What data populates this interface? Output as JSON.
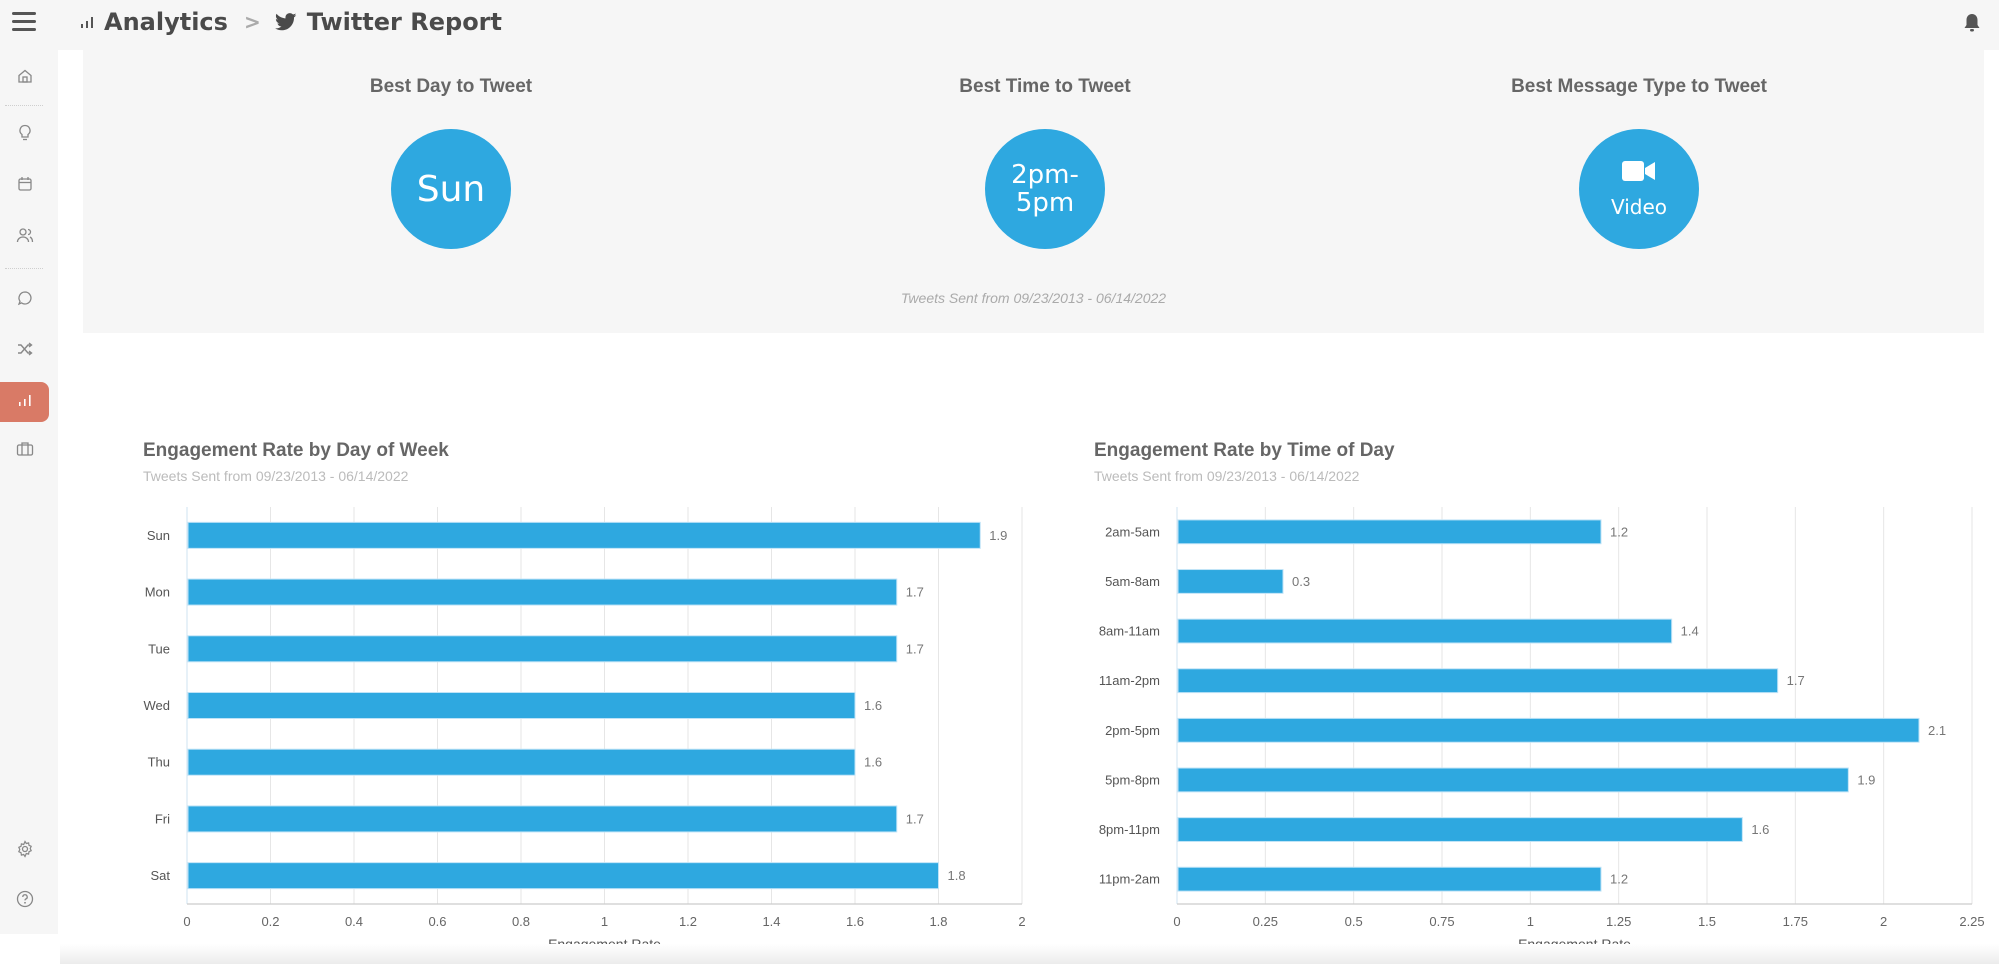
{
  "header": {
    "breadcrumb": [
      {
        "label": "Analytics",
        "icon": "analytics-icon"
      },
      {
        "label": "Twitter Report",
        "icon": "twitter-icon"
      }
    ],
    "separator": ">",
    "notifications_icon": "bell-icon"
  },
  "sidebar": {
    "items": [
      {
        "name": "home",
        "icon": "home-icon",
        "active": false
      },
      {
        "name": "ideas",
        "icon": "lightbulb-icon",
        "active": false
      },
      {
        "name": "calendar",
        "icon": "calendar-icon",
        "active": false
      },
      {
        "name": "audience",
        "icon": "users-icon",
        "active": false
      },
      {
        "name": "messages",
        "icon": "chat-icon",
        "active": false
      },
      {
        "name": "automation",
        "icon": "shuffle-icon",
        "active": false
      },
      {
        "name": "analytics",
        "icon": "analytics-icon",
        "active": true
      },
      {
        "name": "tools",
        "icon": "briefcase-icon",
        "active": false
      },
      {
        "name": "settings",
        "icon": "gear-icon",
        "active": false
      },
      {
        "name": "help",
        "icon": "help-icon",
        "active": false
      }
    ],
    "active_color": "#d97a66"
  },
  "summary": {
    "cards": [
      {
        "title": "Best Day to Tweet",
        "value": "Sun"
      },
      {
        "title": "Best Time to Tweet",
        "value_line1": "2pm-",
        "value_line2": "5pm"
      },
      {
        "title": "Best Message Type to Tweet",
        "value": "Video",
        "icon": "video-camera-icon"
      }
    ],
    "note": "Tweets Sent from 09/23/2013 - 06/14/2022",
    "accent": "#2ea8e0"
  },
  "chart_data": [
    {
      "type": "bar",
      "orientation": "horizontal",
      "title": "Engagement Rate by Day of Week",
      "subtitle": "Tweets Sent from 09/23/2013 - 06/14/2022",
      "categories": [
        "Sun",
        "Mon",
        "Tue",
        "Wed",
        "Thu",
        "Fri",
        "Sat"
      ],
      "values": [
        1.9,
        1.7,
        1.7,
        1.6,
        1.6,
        1.7,
        1.8
      ],
      "value_labels": [
        "1.9",
        "1.7",
        "1.7",
        "1.6",
        "1.6",
        "1.7",
        "1.8"
      ],
      "xlabel": "Engagement Rate",
      "ylabel": "",
      "xlim": [
        0,
        2
      ],
      "xticks": [
        0,
        0.2,
        0.4,
        0.6,
        0.8,
        1,
        1.2,
        1.4,
        1.6,
        1.8,
        2
      ],
      "xtick_labels": [
        "0",
        "0.2",
        "0.4",
        "0.6",
        "0.8",
        "1",
        "1.2",
        "1.4",
        "1.6",
        "1.8",
        "2"
      ],
      "grid": true,
      "color": "#2ea8e0"
    },
    {
      "type": "bar",
      "orientation": "horizontal",
      "title": "Engagement Rate by Time of Day",
      "subtitle": "Tweets Sent from 09/23/2013 - 06/14/2022",
      "categories": [
        "2am-5am",
        "5am-8am",
        "8am-11am",
        "11am-2pm",
        "2pm-5pm",
        "5pm-8pm",
        "8pm-11pm",
        "11pm-2am"
      ],
      "values": [
        1.2,
        0.3,
        1.4,
        1.7,
        2.1,
        1.9,
        1.6,
        1.2
      ],
      "value_labels": [
        "1.2",
        "0.3",
        "1.4",
        "1.7",
        "2.1",
        "1.9",
        "1.6",
        "1.2"
      ],
      "xlabel": "Engagement Rate",
      "ylabel": "",
      "xlim": [
        0,
        2.25
      ],
      "xticks": [
        0,
        0.25,
        0.5,
        0.75,
        1,
        1.25,
        1.5,
        1.75,
        2,
        2.25
      ],
      "xtick_labels": [
        "0",
        "0.25",
        "0.5",
        "0.75",
        "1",
        "1.25",
        "1.5",
        "1.75",
        "2",
        "2.25"
      ],
      "grid": true,
      "color": "#2ea8e0"
    }
  ]
}
